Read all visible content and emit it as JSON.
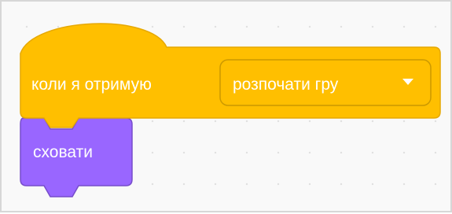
{
  "workspace": {
    "background": "#f9f9f9",
    "grid_dots": true
  },
  "hat_block": {
    "category": "events",
    "color": "#ffbf00",
    "border_color": "#e6a800",
    "label": "коли я отримую",
    "broadcast_dropdown": {
      "selected": "розпочати гру",
      "icon": "dropdown-arrow-icon",
      "pill_color": "#ffbf00",
      "pill_border": "#cc9900"
    }
  },
  "stack_block": {
    "category": "looks",
    "color": "#9966ff",
    "border_color": "#774dcb",
    "label": "сховати"
  }
}
